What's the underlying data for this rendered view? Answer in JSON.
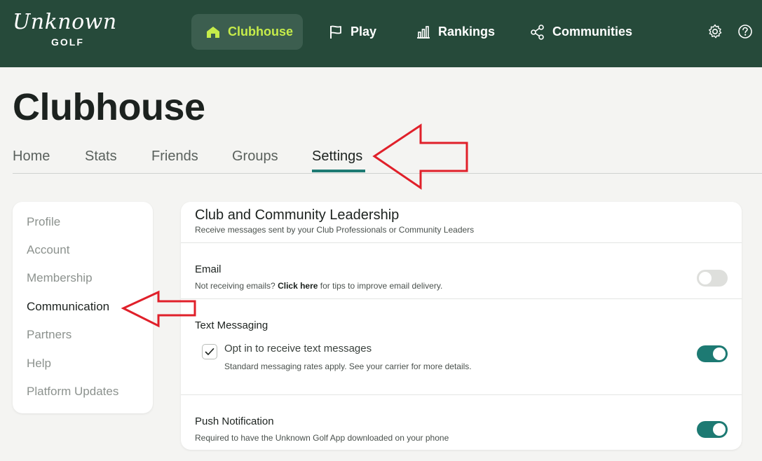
{
  "brand": {
    "script": "Unknown",
    "sub": "GOLF"
  },
  "nav": {
    "items": [
      {
        "label": "Clubhouse",
        "icon": "home-icon",
        "active": true
      },
      {
        "label": "Play",
        "icon": "flag-icon"
      },
      {
        "label": "Rankings",
        "icon": "bar-chart-icon"
      },
      {
        "label": "Communities",
        "icon": "share-icon"
      }
    ],
    "settings_icon": "gear-icon",
    "help_icon": "help-icon"
  },
  "page": {
    "title": "Clubhouse"
  },
  "tabs": [
    {
      "label": "Home"
    },
    {
      "label": "Stats"
    },
    {
      "label": "Friends"
    },
    {
      "label": "Groups"
    },
    {
      "label": "Settings",
      "active": true
    }
  ],
  "sidebar": {
    "items": [
      {
        "label": "Profile"
      },
      {
        "label": "Account"
      },
      {
        "label": "Membership"
      },
      {
        "label": "Communication",
        "active": true
      },
      {
        "label": "Partners"
      },
      {
        "label": "Help"
      },
      {
        "label": "Platform Updates"
      }
    ]
  },
  "section": {
    "title": "Club and Community Leadership",
    "subtitle": "Receive messages sent by your Club Professionals or Community Leaders",
    "email": {
      "title": "Email",
      "note_prefix": "Not receiving emails?",
      "note_link": "Click here",
      "note_suffix": "for tips to improve email delivery.",
      "enabled": false
    },
    "sms": {
      "title": "Text Messaging",
      "checkbox_label": "Opt in to receive text messages",
      "checkbox_note": "Standard messaging rates apply. See your carrier for more details.",
      "checked": true,
      "enabled": true
    },
    "push": {
      "title": "Push Notification",
      "note": "Required to have the Unknown Golf App downloaded on your phone",
      "enabled": true
    }
  },
  "colors": {
    "header_bg": "#264a3a",
    "active_nav_bg": "#3c5e4f",
    "active_nav_text": "#c6ec4a",
    "accent": "#1d7a73",
    "annotation_red": "#e0202a"
  }
}
